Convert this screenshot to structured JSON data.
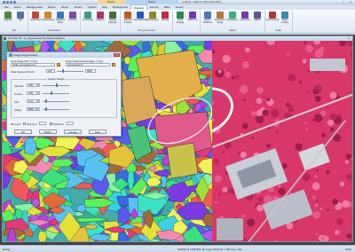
{
  "window": {
    "title": "Untitled - ERDAS IMAGINE 2015",
    "context_tab_a": "Raster",
    "context_tab_b": "Raster",
    "minimize": "–",
    "maximize": "□",
    "close": "✕"
  },
  "tabs": [
    "File",
    "Home",
    "Manage Data",
    "Raster",
    "Vector",
    "Terrain",
    "Toolbox",
    "Help",
    "Multispectral",
    "Drawing",
    "Format",
    "Table",
    "Terrain"
  ],
  "active_tab_index": 9,
  "ribbon_groups": [
    {
      "label": "Edit",
      "buttons": [
        {
          "label": "Segment",
          "icon": "segment-icon",
          "color": "#4a8a3a"
        },
        {
          "label": "Edit",
          "icon": "edit-icon",
          "color": "#5576a8"
        }
      ]
    },
    {
      "label": "Classification",
      "buttons": [
        {
          "label": "Supervised",
          "icon": "supervised-icon",
          "color": "#c04a3a"
        },
        {
          "label": "Unsupervised",
          "icon": "unsupervised-icon",
          "color": "#d08a2a"
        },
        {
          "label": "Signature Editor",
          "icon": "signature-icon",
          "color": "#3a7ac0"
        },
        {
          "label": "Accuracy",
          "icon": "accuracy-icon",
          "color": "#7a4aa8"
        }
      ]
    },
    {
      "label": "",
      "buttons": [
        {
          "label": "Knowledge",
          "icon": "knowledge-icon",
          "color": "#3a9a8a"
        },
        {
          "label": "Subpixel",
          "icon": "subpixel-icon",
          "color": "#a83a6a"
        },
        {
          "label": "Feature Objective",
          "icon": "feature-icon",
          "color": "#4a6a3a"
        }
      ]
    },
    {
      "label": "Change Detection",
      "buttons": [
        {
          "label": "Spectral Analysis",
          "icon": "spectral-icon",
          "color": "#c05a2a"
        },
        {
          "label": "Hyperspectral",
          "icon": "hyper-icon",
          "color": "#2a5ac0"
        },
        {
          "label": "Discriminant",
          "icon": "discriminant-icon",
          "color": "#8a8a2a"
        },
        {
          "label": "Change",
          "icon": "change-icon",
          "color": "#c02a4a"
        }
      ]
    },
    {
      "label": "",
      "buttons": [
        {
          "label": "Zonal Change",
          "icon": "zonal-icon",
          "color": "#2a8a5a"
        },
        {
          "label": "Difference",
          "icon": "difference-icon",
          "color": "#6a3ac0"
        }
      ]
    },
    {
      "label": "Utilities",
      "buttons": [
        {
          "label": "Raster Attributes",
          "icon": "raster-attr-icon",
          "color": "#4a7ab0"
        },
        {
          "label": "Resolution Merge",
          "icon": "merge-icon",
          "color": "#b07a3a"
        },
        {
          "label": "Pansharpen",
          "icon": "pansharpen-icon",
          "color": "#3ab07a"
        },
        {
          "label": "Geometric",
          "icon": "geometric-icon",
          "color": "#7a3ab0"
        },
        {
          "label": "Utilities",
          "icon": "utilities-icon",
          "color": "#5a5a8a"
        }
      ]
    },
    {
      "label": "Radar",
      "buttons": [
        {
          "label": "Interferometry",
          "icon": "interferometry-icon",
          "color": "#b03a3a"
        },
        {
          "label": "Radar Toolbox",
          "icon": "radar-icon",
          "color": "#3a8ab0"
        }
      ]
    }
  ],
  "image_window": {
    "title": "2D View #1 : fo_segmented.img (Segmentation)",
    "close": "✕"
  },
  "dialog": {
    "title": "Image Segmentation",
    "close": "✕",
    "input_label": "Input Image File: (*.img)",
    "input_value": "wh45_ecunorthern.img",
    "output_label": "Output Segmented Image: (*.img)",
    "output_value": "segmented.img",
    "pixel_label": "Pixel Segment Pixels:",
    "pixel_min": "100",
    "pixel_max": "8000",
    "group_label": "Feature Weights",
    "spectral_label": "Spectral",
    "spectral_value": "0.50",
    "texture_label": "Texture",
    "texture_value": "0.30",
    "size_label": "Size",
    "size_value": "0.10",
    "shape_label": "Shape",
    "shape_value": "0.10",
    "min_label": "Min Limit",
    "min_value": "Minimum",
    "max_value": "Maximum",
    "ok_label": "OK",
    "batch_label": "Batch",
    "cancel_label": "Cancel",
    "help_label": "Help"
  },
  "status": {
    "left": "Ready",
    "coords": "636285.23  19964652.18  meters   WGS 84 / UTM Zone 43N",
    "zoom": "100%"
  }
}
